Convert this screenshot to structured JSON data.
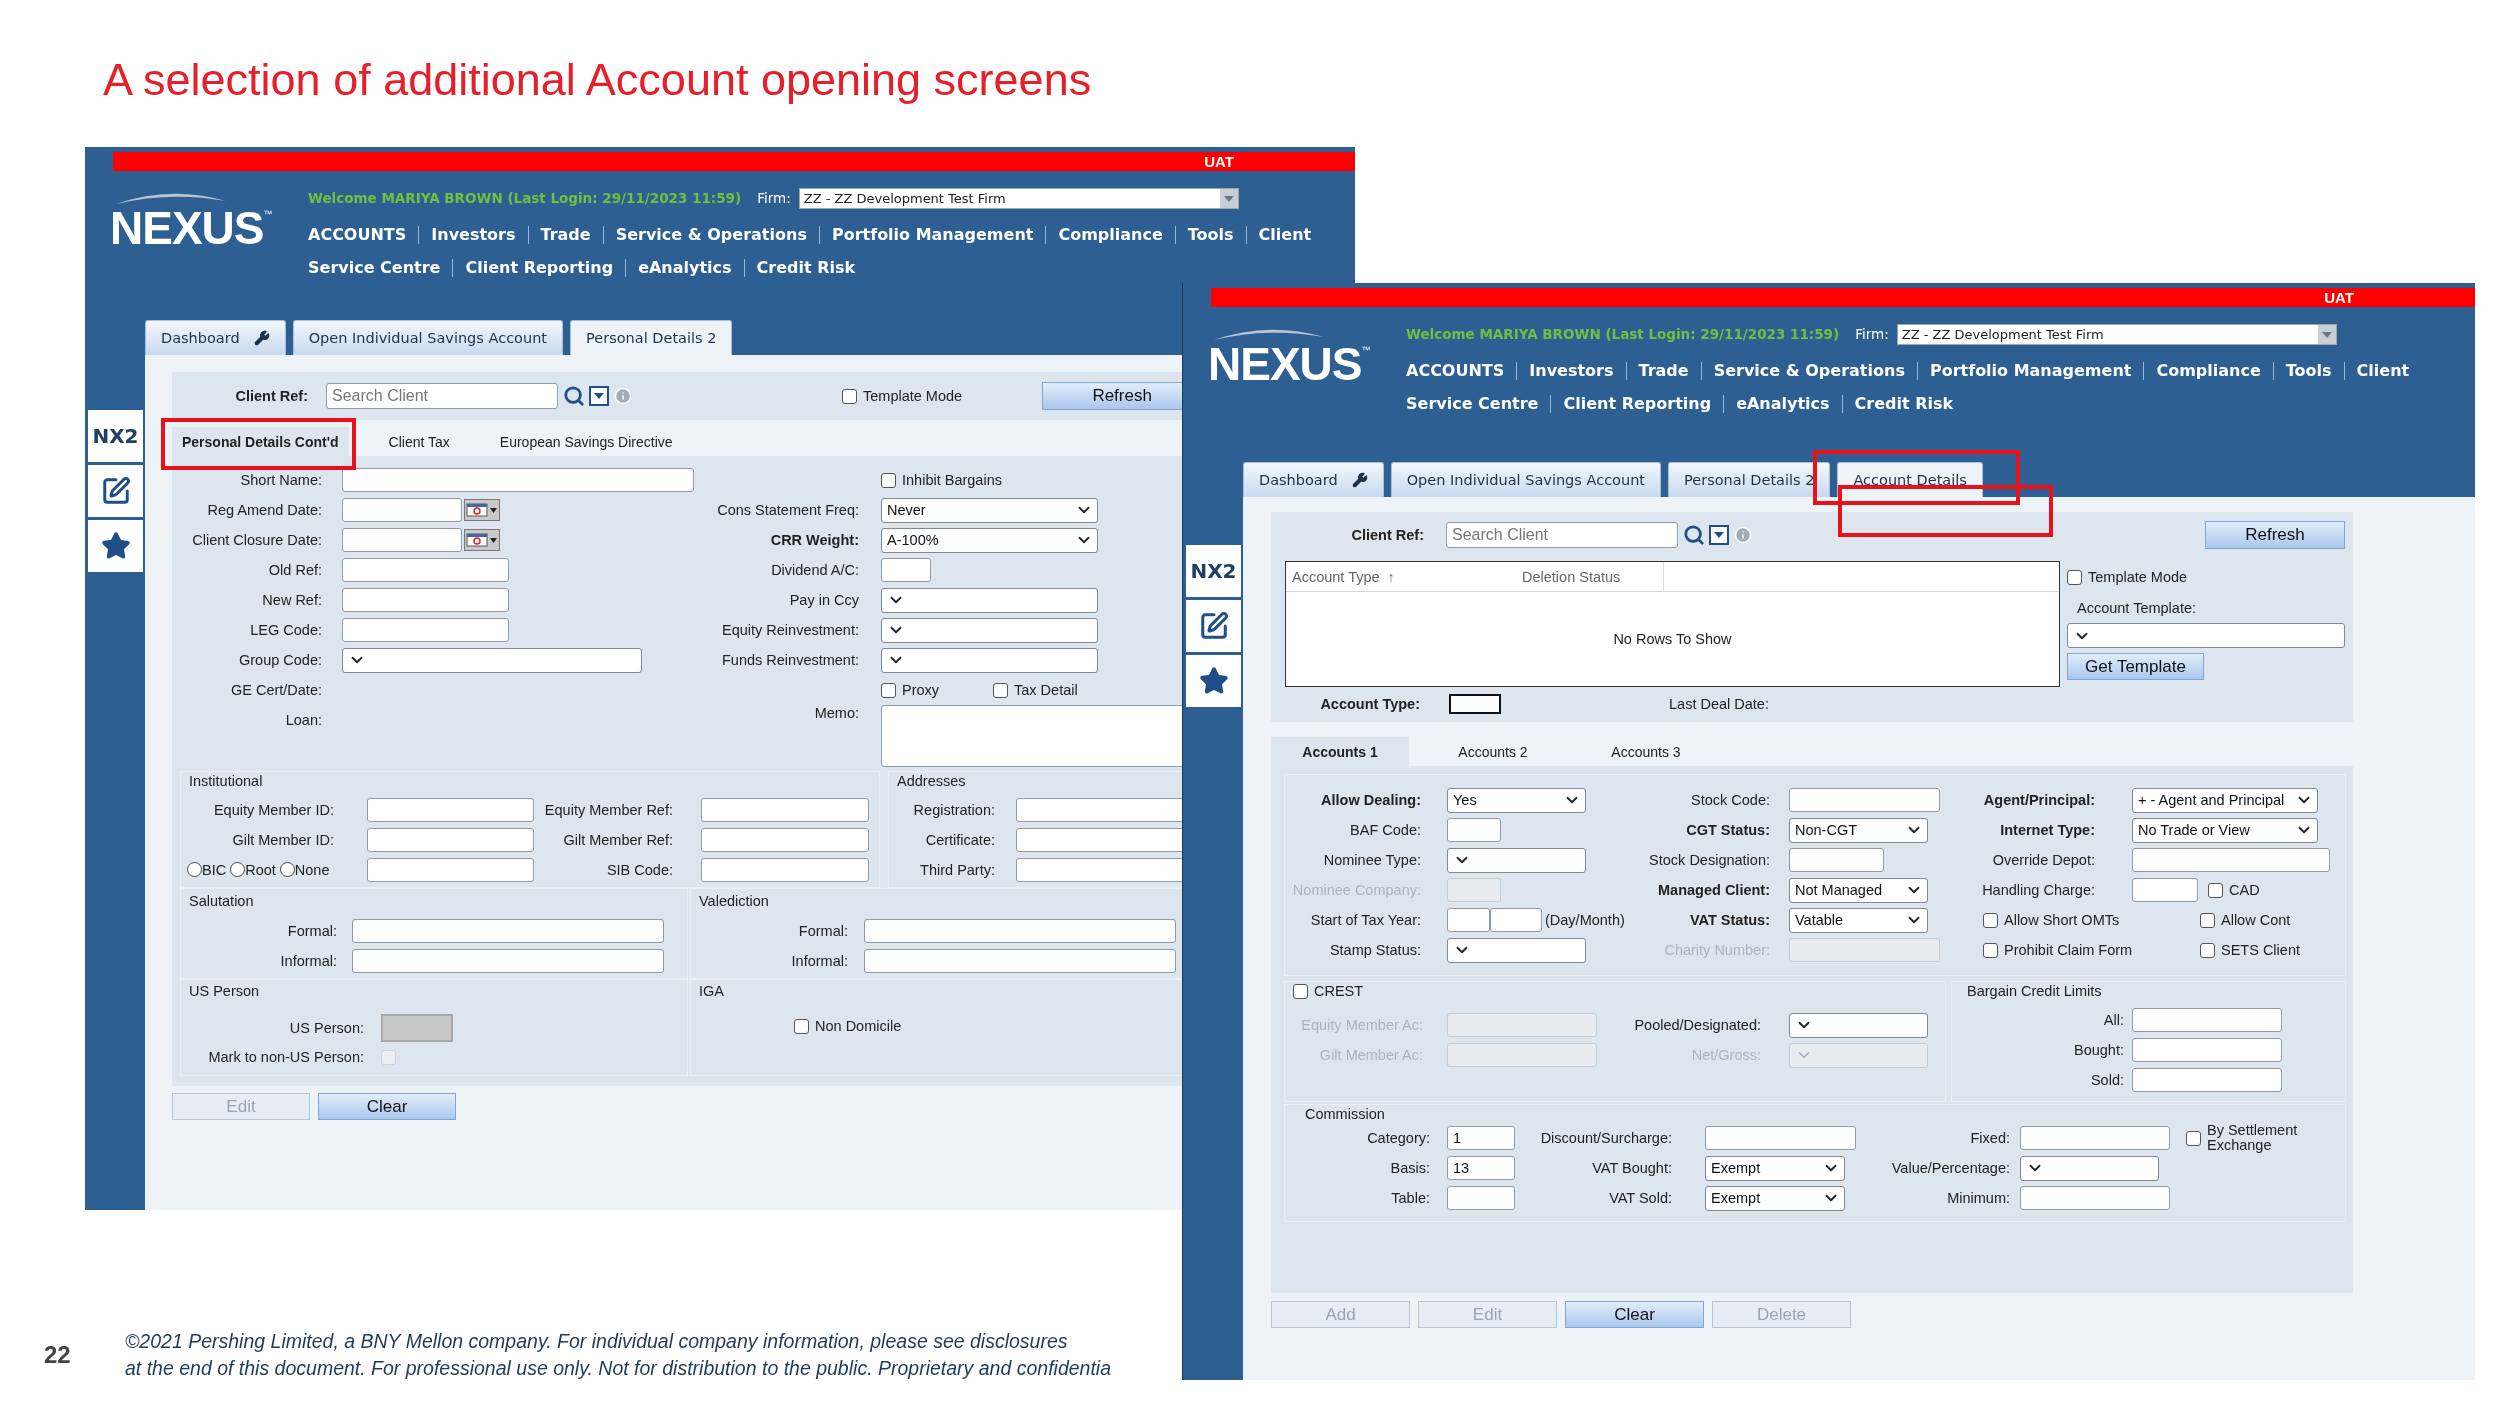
{
  "title": "A selection of additional Account opening screens",
  "page_number": "22",
  "footer": [
    "©2021 Pershing Limited, a BNY Mellon company. For individual company information, please see disclosures",
    "at the end of this document. For professional use only. Not for distribution to the public. Proprietary and confidentia"
  ],
  "screens": [
    {
      "env": "UAT",
      "logo": "NEXUS",
      "trademark": "™",
      "welcome": "Welcome MARIYA BROWN (Last Login: 29/11/2023 11:59)",
      "firm_label": "Firm:",
      "firm": "ZZ - ZZ Development Test Firm",
      "menu": [
        [
          "ACCOUNTS",
          "Investors",
          "Trade",
          "Service & Operations",
          "Portfolio Management",
          "Compliance",
          "Tools",
          "Client"
        ],
        [
          "Service Centre",
          "Client Reporting",
          "eAnalytics",
          "Credit Risk"
        ]
      ],
      "side_label": "NX2",
      "tabs": [
        {
          "label": "Dashboard",
          "selected": false,
          "highlighted": false
        },
        {
          "label": "Open Individual Savings Account",
          "selected": false,
          "highlighted": false
        },
        {
          "label": "Personal Details 2",
          "selected": true,
          "highlighted": false
        }
      ],
      "client_ref": {
        "label": "Client Ref:",
        "placeholder": "Search Client"
      },
      "template_mode": {
        "label": "Template Mode",
        "checked": false
      },
      "refresh": "Refresh",
      "subtabs": [
        {
          "label": "Personal Details Cont'd",
          "selected": true,
          "highlighted": true
        },
        {
          "label": "Client Tax",
          "selected": false,
          "highlighted": false
        },
        {
          "label": "European Savings Directive",
          "selected": false,
          "highlighted": false
        }
      ],
      "details": [
        [
          {
            "label": "Short Name:",
            "kind": "wide"
          },
          {
            "label": "Reg Amend Date:",
            "kind": "date"
          },
          {
            "label": "Client Closure Date:",
            "kind": "date"
          },
          {
            "label": "Old Ref:",
            "kind": "text"
          },
          {
            "label": "New Ref:",
            "kind": "text"
          },
          {
            "label": "LEG Code:",
            "kind": "text"
          },
          {
            "label": "Group Code:",
            "kind": "select"
          },
          {
            "label": "GE Cert/Date:",
            "kind": "label"
          },
          {
            "label": "Loan:",
            "kind": "label"
          }
        ],
        [
          {
            "label": "Inhibit Bargains",
            "kind": "checkbox",
            "checked": false
          },
          {
            "label": "Cons Statement Freq:",
            "kind": "select",
            "value": "Never"
          },
          {
            "label": "CRR Weight:",
            "kind": "select",
            "value": "A-100%",
            "bold": true
          },
          {
            "label": "Dividend A/C:",
            "kind": "short"
          },
          {
            "label": "Pay in Ccy",
            "kind": "select"
          },
          {
            "label": "Equity Reinvestment:",
            "kind": "select"
          },
          {
            "label": "Funds Reinvestment:",
            "kind": "select"
          },
          {
            "kind": "checks",
            "checks": [
              {
                "label": "Proxy",
                "checked": false
              },
              {
                "label": "Tax Detail",
                "checked": false
              }
            ]
          },
          {
            "label": "Memo:",
            "kind": "textarea"
          }
        ]
      ],
      "institutional": {
        "title": "Institutional",
        "columns": [
          [
            {
              "label": "Equity Member ID:",
              "kind": "text"
            },
            {
              "label": "Gilt Member ID:",
              "kind": "text"
            },
            {
              "kind": "radiotext",
              "radios": [
                {
                  "label": "BIC",
                  "selected": false
                },
                {
                  "label": "Root",
                  "selected": false
                },
                {
                  "label": "None",
                  "selected": false
                }
              ]
            }
          ],
          [
            {
              "label": "Equity Member Ref:",
              "kind": "text"
            },
            {
              "label": "Gilt Member Ref:",
              "kind": "text"
            },
            {
              "label": "SIB Code:",
              "kind": "text"
            }
          ]
        ]
      },
      "addresses": {
        "title": "Addresses",
        "fields": [
          {
            "label": "Registration:",
            "kind": "text"
          },
          {
            "label": "Certificate:",
            "kind": "text"
          },
          {
            "label": "Third Party:",
            "kind": "text"
          }
        ]
      },
      "salutation": {
        "title": "Salutation",
        "fields": [
          {
            "label": "Formal:",
            "kind": "wide"
          },
          {
            "label": "Informal:",
            "kind": "wide"
          }
        ]
      },
      "valediction": {
        "title": "Valediction",
        "fields": [
          {
            "label": "Formal:",
            "kind": "wide"
          },
          {
            "label": "Informal:",
            "kind": "wide"
          }
        ]
      },
      "us_person": {
        "title": "US Person",
        "fields": [
          {
            "label": "US Person:",
            "kind": "greybox"
          },
          {
            "label": "Mark to non-US Person:",
            "kind": "lockedcheck",
            "checked": false
          }
        ]
      },
      "iga": {
        "title": "IGA",
        "fields": [
          {
            "label": "Non Domicile",
            "kind": "checkbox",
            "checked": false
          }
        ]
      },
      "buttons": [
        {
          "label": "Edit",
          "disabled": true
        },
        {
          "label": "Clear",
          "disabled": false
        }
      ]
    },
    {
      "env": "UAT",
      "logo": "NEXUS",
      "trademark": "™",
      "welcome": "Welcome MARIYA BROWN (Last Login: 29/11/2023 11:59)",
      "firm_label": "Firm:",
      "firm": "ZZ - ZZ Development Test Firm",
      "menu": [
        [
          "ACCOUNTS",
          "Investors",
          "Trade",
          "Service & Operations",
          "Portfolio Management",
          "Compliance",
          "Tools",
          "Client"
        ],
        [
          "Service Centre",
          "Client Reporting",
          "eAnalytics",
          "Credit Risk"
        ]
      ],
      "side_label": "NX2",
      "tabs": [
        {
          "label": "Dashboard",
          "selected": false,
          "highlighted": false
        },
        {
          "label": "Open Individual Savings Account",
          "selected": false,
          "highlighted": false
        },
        {
          "label": "Personal Details 2",
          "selected": false,
          "highlighted": false
        },
        {
          "label": "Account Details",
          "selected": true,
          "highlighted": true
        }
      ],
      "client_ref": {
        "label": "Client Ref:",
        "placeholder": "Search Client"
      },
      "refresh": "Refresh",
      "grid": {
        "columns": [
          {
            "label": "Account Type",
            "sort": "↑"
          },
          {
            "label": "Deletion Status"
          }
        ],
        "empty": "No Rows To Show"
      },
      "template_mode": {
        "label": "Template Mode",
        "checked": false
      },
      "account_template": {
        "label": "Account Template:"
      },
      "get_template": "Get Template",
      "account_type": {
        "label": "Account Type:"
      },
      "last_deal_date": {
        "label": "Last Deal Date:"
      },
      "subtabs": [
        {
          "label": "Accounts 1",
          "selected": true,
          "highlighted": false
        },
        {
          "label": "Accounts 2",
          "selected": false,
          "highlighted": false
        },
        {
          "label": "Accounts 3",
          "selected": false,
          "highlighted": false
        }
      ],
      "dealing": [
        [
          {
            "label": "Allow Dealing:",
            "kind": "select",
            "value": "Yes",
            "bold": true
          },
          {
            "label": "BAF Code:",
            "kind": "short"
          },
          {
            "label": "Nominee Type:",
            "kind": "select"
          },
          {
            "label": "Nominee Company:",
            "kind": "stub"
          },
          {
            "label": "Start of Tax Year:",
            "kind": "daymonth",
            "hint": "(Day/Month)"
          },
          {
            "label": "Stamp Status:",
            "kind": "select"
          }
        ],
        [
          {
            "label": "Stock Code:",
            "kind": "text"
          },
          {
            "label": "CGT Status:",
            "kind": "select",
            "value": "Non-CGT",
            "bold": true
          },
          {
            "label": "Stock Designation:",
            "kind": "medium"
          },
          {
            "label": "Managed Client:",
            "kind": "select",
            "value": "Not Managed",
            "bold": true
          },
          {
            "label": "VAT Status:",
            "kind": "select",
            "value": "Vatable",
            "bold": true
          },
          {
            "label": "Charity Number:",
            "kind": "readonly"
          }
        ],
        [
          {
            "label": "Agent/Principal:",
            "kind": "select",
            "value": "+ - Agent and Principal",
            "bold": true
          },
          {
            "label": "Internet Type:",
            "kind": "select",
            "value": "No Trade or View",
            "bold": true
          },
          {
            "label": "Override Depot:",
            "kind": "wide"
          },
          {
            "label": "Handling Charge:",
            "kind": "short",
            "check": {
              "label": "CAD",
              "checked": false
            }
          },
          {
            "kind": "checks",
            "checks": [
              {
                "label": "Allow Short OMTs",
                "checked": false
              },
              {
                "label": "Allow Cont",
                "checked": false
              }
            ]
          },
          {
            "kind": "checks",
            "checks": [
              {
                "label": "Prohibit Claim Form",
                "checked": false
              },
              {
                "label": "SETS Client",
                "checked": false
              }
            ]
          }
        ]
      ],
      "crest": {
        "check": {
          "label": "CREST",
          "checked": false
        },
        "columns": [
          [
            {
              "label": "Equity Member Ac:",
              "kind": "readonly"
            },
            {
              "label": "Gilt Member Ac:",
              "kind": "readonly"
            }
          ],
          [
            {
              "label": "Pooled/Designated:",
              "kind": "select"
            },
            {
              "label": "Net/Gross:",
              "kind": "locked"
            }
          ]
        ]
      },
      "bargain": {
        "title": "Bargain Credit Limits",
        "fields": [
          {
            "label": "All:",
            "kind": "text"
          },
          {
            "label": "Bought:",
            "kind": "text"
          },
          {
            "label": "Sold:",
            "kind": "text"
          }
        ]
      },
      "commission": {
        "title": "Commission",
        "columns": [
          [
            {
              "label": "Category:",
              "kind": "text",
              "value": "1"
            },
            {
              "label": "Basis:",
              "kind": "text",
              "value": "13"
            },
            {
              "label": "Table:",
              "kind": "text"
            }
          ],
          [
            {
              "label": "Discount/Surcharge:",
              "kind": "text"
            },
            {
              "label": "VAT Bought:",
              "kind": "select",
              "value": "Exempt"
            },
            {
              "label": "VAT Sold:",
              "kind": "select",
              "value": "Exempt"
            }
          ],
          [
            {
              "label": "Fixed:",
              "kind": "text",
              "check": {
                "label": "By Settlement Exchange",
                "checked": false
              }
            },
            {
              "label": "Value/Percentage:",
              "kind": "select"
            },
            {
              "label": "Minimum:",
              "kind": "text"
            }
          ]
        ]
      },
      "buttons": [
        {
          "label": "Add",
          "disabled": true
        },
        {
          "label": "Edit",
          "disabled": true
        },
        {
          "label": "Clear",
          "disabled": false
        },
        {
          "label": "Delete",
          "disabled": true
        }
      ]
    }
  ]
}
